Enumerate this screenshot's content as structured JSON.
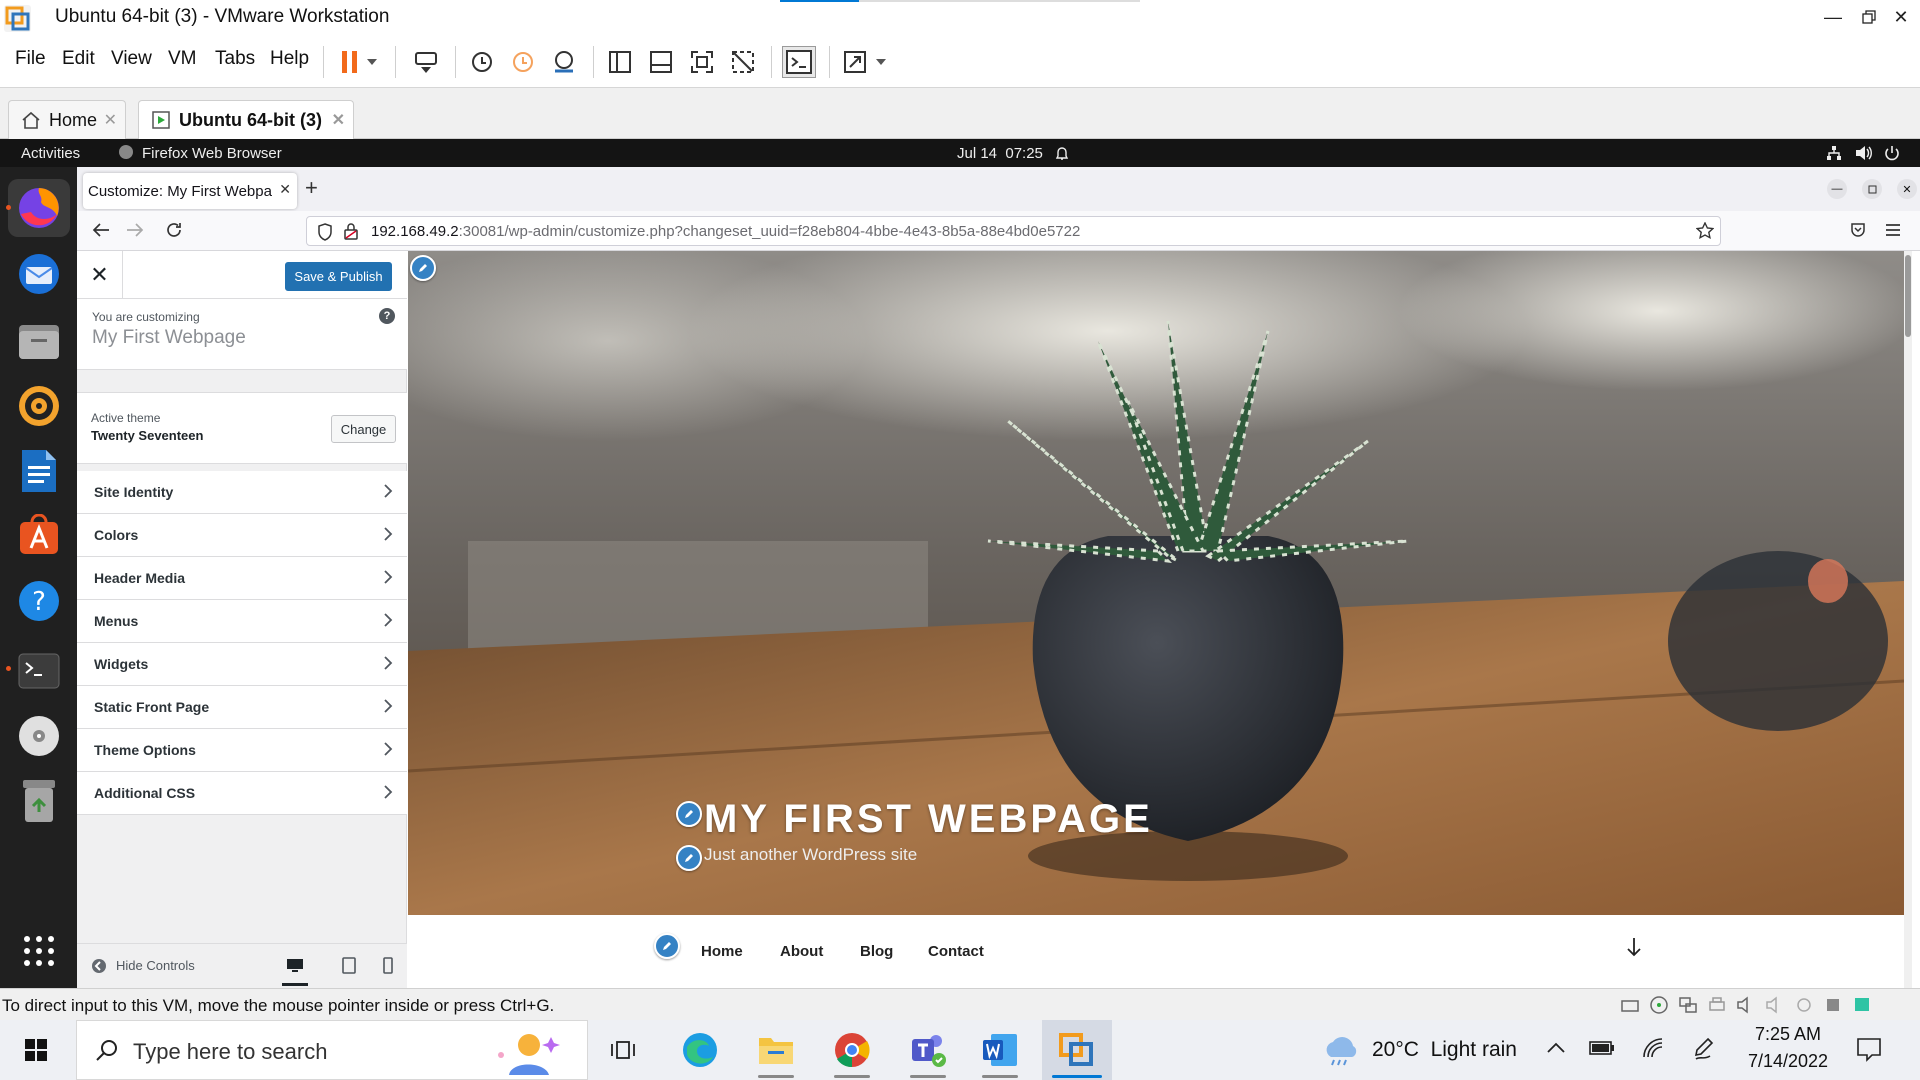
{
  "vmware": {
    "title": "Ubuntu 64-bit (3) - VMware Workstation",
    "menus": [
      "File",
      "Edit",
      "View",
      "VM",
      "Tabs",
      "Help"
    ],
    "tabs": [
      {
        "label": "Home",
        "icon": "home-icon"
      },
      {
        "label": "Ubuntu 64-bit (3)",
        "icon": "vm-icon"
      }
    ],
    "status_text": "To direct input to this VM, move the mouse pointer inside or press Ctrl+G."
  },
  "ubuntu": {
    "activities": "Activities",
    "app_name": "Firefox Web Browser",
    "clock": "Jul 14  07:25",
    "dock": [
      "firefox-icon",
      "thunderbird-icon",
      "files-icon",
      "rhythmbox-icon",
      "writer-icon",
      "app-center-icon",
      "help-icon",
      "terminal-icon",
      "disc-icon",
      "trash-icon",
      "show-apps-icon"
    ]
  },
  "firefox": {
    "tab_title": "Customize: My First Webpage",
    "url_host": "192.168.49.2",
    "url_rest": ":30081/wp-admin/customize.php?changeset_uuid=f28eb804-4bbe-4e43-8b5a-88e4bd0e5722"
  },
  "customizer": {
    "save_label": "Save & Publish",
    "customizing_label": "You are customizing",
    "site_name": "My First Webpage",
    "active_theme_label": "Active theme",
    "theme_name": "Twenty Seventeen",
    "change_label": "Change",
    "sections": [
      "Site Identity",
      "Colors",
      "Header Media",
      "Menus",
      "Widgets",
      "Static Front Page",
      "Theme Options",
      "Additional CSS"
    ],
    "hide_controls": "Hide Controls"
  },
  "preview": {
    "site_title": "MY FIRST WEBPAGE",
    "tagline": "Just another WordPress site",
    "nav": [
      "Home",
      "About",
      "Blog",
      "Contact"
    ]
  },
  "taskbar": {
    "search_placeholder": "Type here to search",
    "weather": "20°C  Light rain",
    "time": "7:25 AM",
    "date": "7/14/2022"
  },
  "colors": {
    "wp_blue": "#2271b1",
    "ubuntu_orange": "#e95420",
    "windows_blue": "#0078d4"
  }
}
